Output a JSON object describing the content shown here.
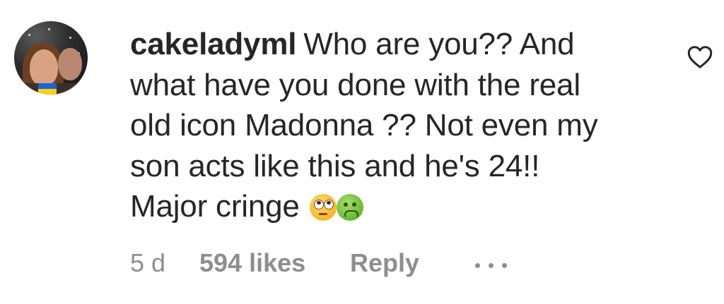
{
  "comment": {
    "username": "cakeladyml",
    "text_lines": [
      "Who are you?? And",
      "what have you done with the real",
      "old icon Madonna ?? Not even my",
      "son acts like this and he's 24!!",
      "Major cringe"
    ],
    "emojis": [
      "face-with-rolling-eyes-icon",
      "nauseated-face-icon"
    ],
    "time": "5 d",
    "likes": "594 likes",
    "reply": "Reply"
  },
  "avatar": {
    "badge_flag_colors": [
      "#1a62d6",
      "#f7d117"
    ]
  },
  "icons": {
    "like": "heart-outline-icon",
    "more": "ellipsis-icon"
  }
}
